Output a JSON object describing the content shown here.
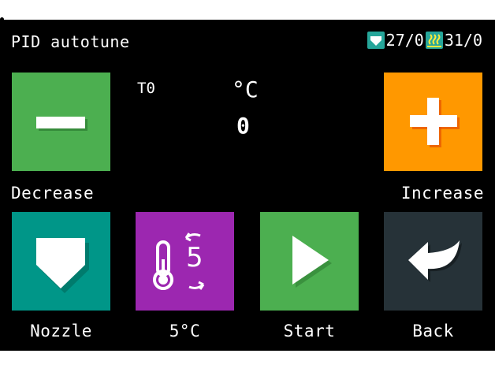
{
  "header": {
    "title": "PID autotune",
    "nozzle_temp": "27/0",
    "bed_temp": "31/0"
  },
  "display": {
    "tool": "T0",
    "unit": "°C",
    "value": "0"
  },
  "buttons": {
    "decrease": "Decrease",
    "increase": "Increase",
    "nozzle": "Nozzle",
    "step": "5°C",
    "step_digit": "5",
    "start": "Start",
    "back": "Back"
  },
  "colors": {
    "green": "#4caf50",
    "orange": "#ff9800",
    "teal": "#009688",
    "purple": "#9c27b0",
    "dark": "#263238",
    "screen": "#000000"
  },
  "icons": {
    "decrease": "minus-icon",
    "increase": "plus-icon",
    "nozzle": "nozzle-icon",
    "step": "thermometer-step-icon",
    "start": "play-icon",
    "back": "back-arrow-icon"
  }
}
